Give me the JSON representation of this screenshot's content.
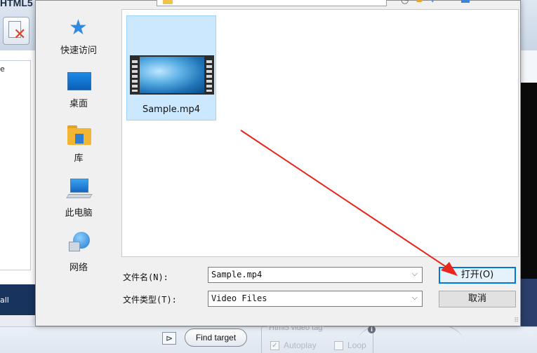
{
  "background_app": {
    "title": "HTML5",
    "left_list_text": "e",
    "left_button_text": "all",
    "find_target_label": "Find target",
    "folder_icon_glyph": "⊳",
    "html5_group_label": "Html5 video tag",
    "info_glyph": "i",
    "autoplay_label": "Autoplay",
    "autoplay_checked": true,
    "loop_label": "Loop",
    "loop_checked": false
  },
  "dialog": {
    "places": [
      {
        "label": "快速访问",
        "icon": "star-icon"
      },
      {
        "label": "桌面",
        "icon": "desktop-icon"
      },
      {
        "label": "库",
        "icon": "library-icon"
      },
      {
        "label": "此电脑",
        "icon": "computer-icon"
      },
      {
        "label": "网络",
        "icon": "network-icon"
      }
    ],
    "files": [
      {
        "name": "Sample.mp4",
        "icon": "video-file-icon",
        "selected": true
      }
    ],
    "filename_label": "文件名(N):",
    "filename_value": "Sample.mp4",
    "filetype_label": "文件类型(T):",
    "filetype_value": "Video Files",
    "open_label": "打开(O)",
    "cancel_label": "取消",
    "dropdown_glyph": "⌵",
    "grip_glyph": "⠿"
  },
  "colors": {
    "selection_bg": "#cce8ff",
    "primary_border": "#0078d7",
    "annotation_arrow": "#e8261c"
  }
}
